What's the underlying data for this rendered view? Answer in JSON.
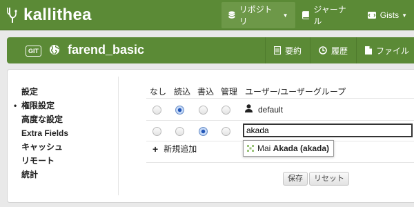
{
  "header": {
    "logo_text": "kallithea",
    "nav": [
      {
        "label": "リポジトリ",
        "icon": "database-icon",
        "has_caret": true,
        "active": true
      },
      {
        "label": "ジャーナル",
        "icon": "book-icon"
      },
      {
        "label": "Gists",
        "icon": "gist-icon",
        "has_caret": true
      }
    ]
  },
  "repo": {
    "type_badge": "GIT",
    "visibility_icon": "globe-icon",
    "name": "farend_basic",
    "actions": [
      {
        "label": "要約",
        "icon": "summary-icon"
      },
      {
        "label": "履歴",
        "icon": "history-icon"
      },
      {
        "label": "ファイル",
        "icon": "file-icon"
      }
    ]
  },
  "sidebar": {
    "items": [
      {
        "label": "設定"
      },
      {
        "label": "権限設定",
        "active": true
      },
      {
        "label": "高度な設定"
      },
      {
        "label": "Extra Fields"
      },
      {
        "label": "キャッシュ"
      },
      {
        "label": "リモート"
      },
      {
        "label": "統計"
      }
    ]
  },
  "permissions": {
    "columns": [
      "なし",
      "読込",
      "書込",
      "管理",
      "ユーザー/ユーザーグループ"
    ],
    "rows": [
      {
        "selected": "読込",
        "user": "default",
        "icon": "user-icon"
      },
      {
        "selected": "書込",
        "input_value": "akada"
      }
    ],
    "add_new_label": "新規追加",
    "suggestion": {
      "prefix": "Mai ",
      "match": "Akada",
      "suffix": " (akada)",
      "avatar_icon": "identicon-avatar-icon"
    }
  },
  "buttons": {
    "save": "保存",
    "reset": "リセット"
  },
  "colors": {
    "brand": "#5b8a36",
    "radio_selected": "#2357b8"
  }
}
